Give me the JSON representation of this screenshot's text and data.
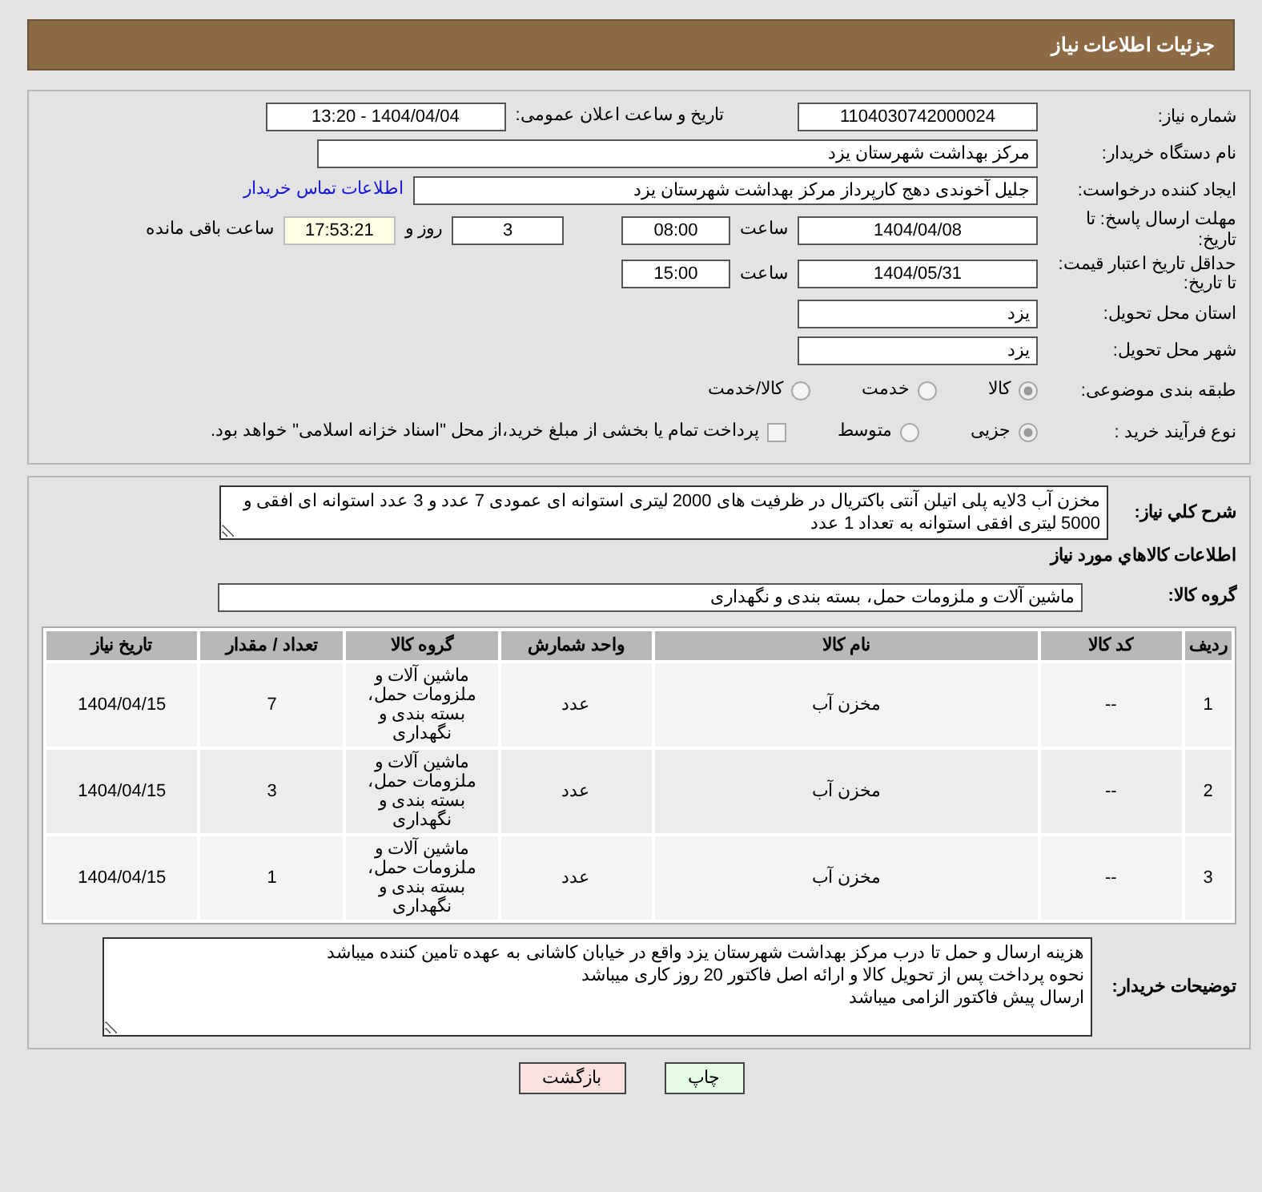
{
  "header": {
    "title": "جزئیات اطلاعات نیاز"
  },
  "need_number": {
    "label": "شماره نیاز:",
    "value": "1104030742000024"
  },
  "announce": {
    "label": "تاریخ و ساعت اعلان عمومی:",
    "value": "1404/04/04 - 13:20"
  },
  "buyer_org": {
    "label": "نام دستگاه خریدار:",
    "value": "مرکز بهداشت شهرستان یزد"
  },
  "requester": {
    "label": "ایجاد کننده درخواست:",
    "value": "جلیل آخوندی دهج کارپرداز مرکز بهداشت شهرستان یزد",
    "link": "اطلاعات تماس خریدار"
  },
  "reply_deadline": {
    "label": "مهلت ارسال پاسخ: تا تاریخ:",
    "date": "1404/04/08",
    "time_label": "ساعت",
    "time": "08:00",
    "days": "3",
    "days_label": "روز و",
    "remaining": "17:53:21",
    "remaining_label": "ساعت باقی مانده"
  },
  "price_validity": {
    "label": "حداقل تاریخ اعتبار قیمت: تا تاریخ:",
    "date": "1404/05/31",
    "time_label": "ساعت",
    "time": "15:00"
  },
  "province": {
    "label": "استان محل تحویل:",
    "value": "یزد"
  },
  "city": {
    "label": "شهر محل تحویل:",
    "value": "یزد"
  },
  "category": {
    "label": "طبقه بندی موضوعی:",
    "options": [
      {
        "label": "کالا",
        "selected": true
      },
      {
        "label": "خدمت",
        "selected": false
      },
      {
        "label": "کالا/خدمت",
        "selected": false
      }
    ]
  },
  "purchase_process": {
    "label": "نوع فرآیند خرید :",
    "options": [
      {
        "label": "جزیی",
        "selected": true
      },
      {
        "label": "متوسط",
        "selected": false
      }
    ],
    "checkbox": {
      "label": "پرداخت تمام یا بخشی از مبلغ خرید،از محل \"اسناد خزانه اسلامی\" خواهد بود.",
      "checked": false
    }
  },
  "description": {
    "label": "شرح کلي نياز:",
    "value": "مخزن آب 3لایه پلی اتیلن آنتی باکتریال در ظرفیت های 2000 لیتری استوانه ای عمودی 7 عدد و 3 عدد استوانه ای افقی و 5000 لیتری افقی استوانه به تعداد 1 عدد"
  },
  "goods_heading": "اطلاعات کالاهاي مورد نياز",
  "goods_group": {
    "label": "گروه کالا:",
    "value": "ماشین آلات و ملزومات حمل، بسته بندی و نگهداری"
  },
  "table": {
    "columns": [
      "ردیف",
      "کد کالا",
      "نام کالا",
      "واحد شمارش",
      "گروه کالا",
      "تعداد / مقدار",
      "تاریخ نیاز"
    ],
    "rows": [
      [
        "1",
        "--",
        "مخزن آب",
        "عدد",
        "ماشین آلات و ملزومات حمل، بسته بندی و نگهداری",
        "7",
        "1404/04/15"
      ],
      [
        "2",
        "--",
        "مخزن آب",
        "عدد",
        "ماشین آلات و ملزومات حمل، بسته بندی و نگهداری",
        "3",
        "1404/04/15"
      ],
      [
        "3",
        "--",
        "مخزن آب",
        "عدد",
        "ماشین آلات و ملزومات حمل، بسته بندی و نگهداری",
        "1",
        "1404/04/15"
      ]
    ]
  },
  "buyer_notes": {
    "label": "توضیحات خریدار:",
    "lines": [
      "هزینه ارسال و حمل تا درب مرکز بهداشت شهرستان یزد واقع در خیابان کاشانی به عهده تامین کننده میباشد",
      "نحوه پرداخت پس از تحویل کالا و ارائه اصل فاکتور 20 روز کاری میباشد",
      "ارسال پیش فاکتور الزامی میباشد"
    ]
  },
  "buttons": [
    {
      "label": "چاپ",
      "kind": "print"
    },
    {
      "label": "بازگشت",
      "kind": "back"
    }
  ]
}
